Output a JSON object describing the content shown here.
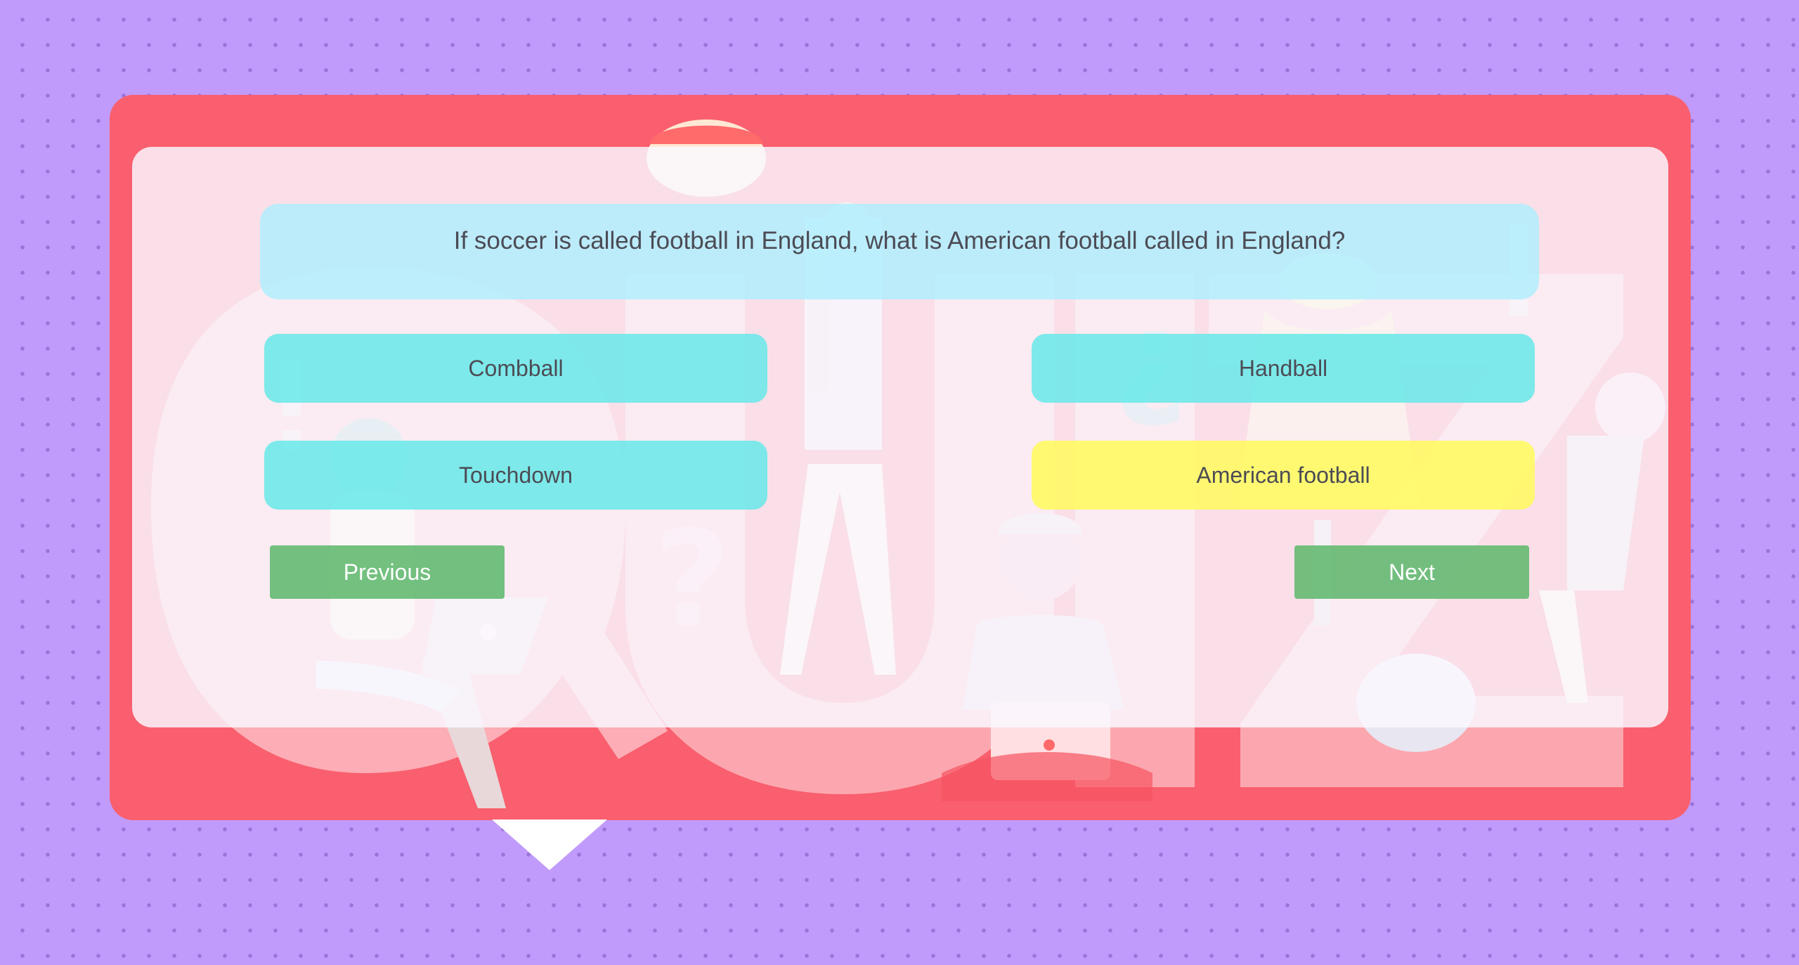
{
  "quiz": {
    "question": "If soccer is called football in England, what is American football called in England?",
    "answers": [
      {
        "label": "Combball",
        "selected": false
      },
      {
        "label": "Handball",
        "selected": false
      },
      {
        "label": "Touchdown",
        "selected": false
      },
      {
        "label": "American football",
        "selected": true
      }
    ],
    "previous_label": "Previous",
    "next_label": "Next"
  },
  "colors": {
    "background": "#c19bfb",
    "board": "#f95f6e",
    "question_bg": "#afeefc",
    "answer_bg": "#65e8e8",
    "answer_selected_bg": "#fffa64",
    "nav_button_bg": "#60b76e"
  }
}
